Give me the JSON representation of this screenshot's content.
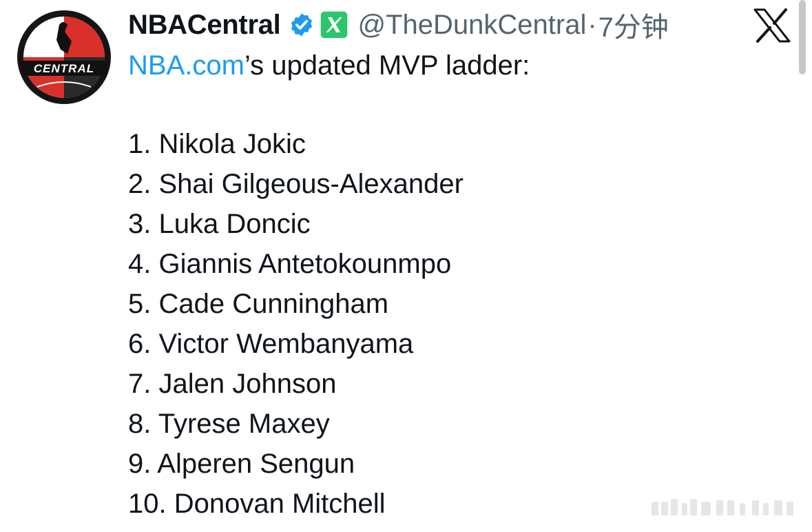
{
  "tweet": {
    "display_name": "NBACentral",
    "handle": "@TheDunkCentral",
    "separator": "·",
    "time_ago": "7分钟",
    "avatar_text": "CENTRAL",
    "link_text": "NBA.com",
    "intro_rest": "’s updated MVP ladder:",
    "ladder": [
      "1. Nikola Jokic",
      "2. Shai Gilgeous-Alexander",
      "3. Luka Doncic",
      "4. Giannis Antetokounmpo",
      "5. Cade Cunningham",
      "6. Victor Wembanyama",
      "7. Jalen Johnson",
      "8. Tyrese Maxey",
      "9. Alperen Sengun",
      "10. Donovan Mitchell"
    ]
  },
  "icons": {
    "verified": "verified-badge-icon",
    "affiliate": "x-affiliate-badge-icon",
    "platform": "x-logo-icon"
  },
  "colors": {
    "link": "#1d9bf0",
    "verified": "#1d9bf0",
    "affiliate": "#2bc56b",
    "text": "#0f1419",
    "muted": "#536471",
    "avatar_red": "#d9302a"
  }
}
